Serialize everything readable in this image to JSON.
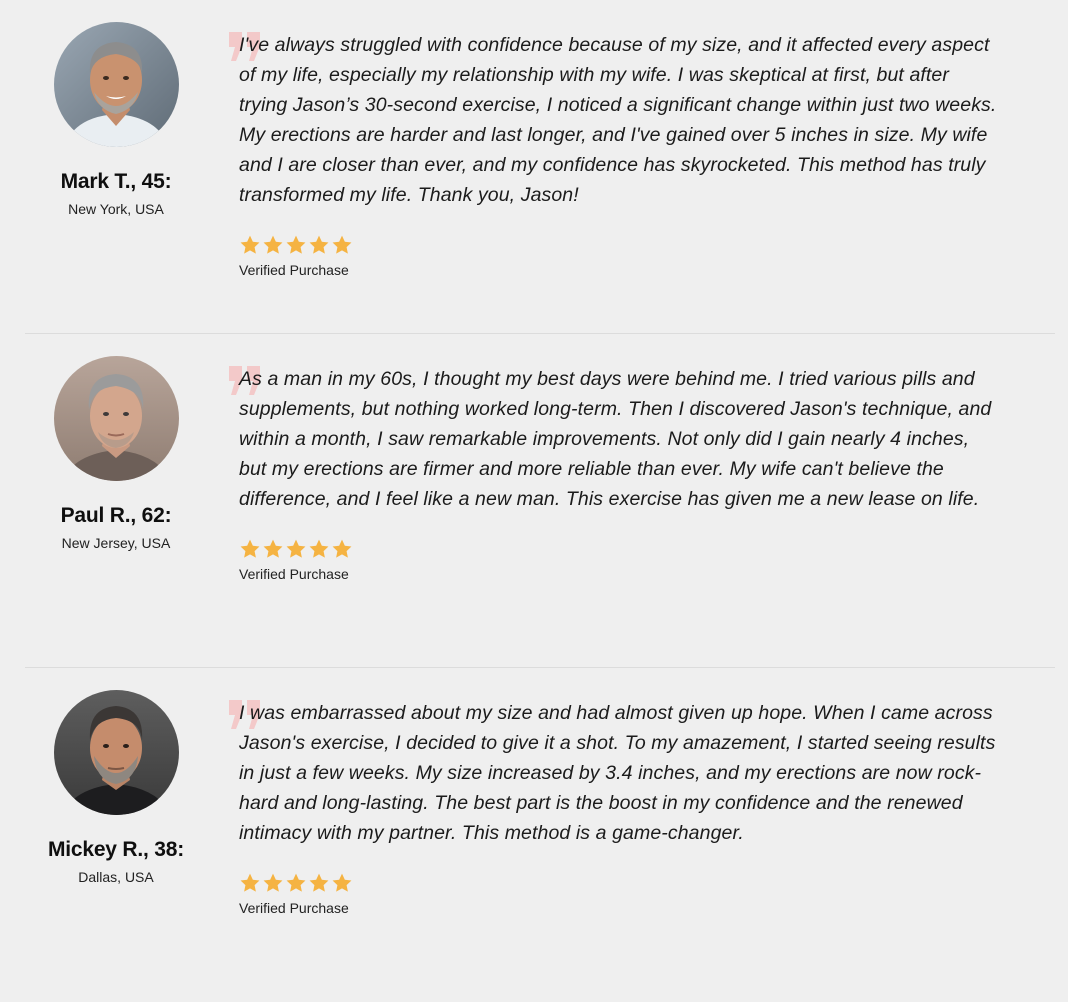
{
  "colors": {
    "background": "#efefef",
    "star": "#f5b342",
    "quote_mark": "#f3c9c9",
    "divider": "#dcdcdc"
  },
  "reviews": [
    {
      "name": "Mark T., 45:",
      "location": "New York, USA",
      "text": "I've always struggled with confidence because of my size, and it affected every aspect of my life, especially my relationship with my wife. I was skeptical at first, but after trying Jason’s 30-second exercise, I noticed a significant change within just two weeks. My erections are harder and last longer, and I've gained over 5 inches in size. My wife and I are closer than ever, and my confidence has skyrocketed. This method has truly transformed my life. Thank you, Jason!",
      "rating": 5,
      "verified_label": "Verified Purchase",
      "avatar_icon": "avatar-photo-icon"
    },
    {
      "name": "Paul R., 62:",
      "location": "New Jersey, USA",
      "text": "As a man in my 60s, I thought my best days were behind me. I tried various pills and supplements, but nothing worked long-term. Then I discovered Jason's technique, and within a month, I saw remarkable improvements. Not only did I gain nearly 4 inches, but my erections are firmer and more reliable than ever. My wife can't believe the difference, and I feel like a new man. This exercise has given me a new lease on life.",
      "rating": 5,
      "verified_label": "Verified Purchase",
      "avatar_icon": "avatar-photo-icon"
    },
    {
      "name": "Mickey R., 38:",
      "location": "Dallas, USA",
      "text": "I was embarrassed about my size and had almost given up hope. When I came across Jason's exercise, I decided to give it a shot. To my amazement, I started seeing results in just a few weeks. My size increased by 3.4 inches, and my erections are now rock-hard and long-lasting. The best part is the boost in my confidence and the renewed intimacy with my partner. This method is a game-changer.",
      "rating": 5,
      "verified_label": "Verified Purchase",
      "avatar_icon": "avatar-photo-icon"
    }
  ]
}
